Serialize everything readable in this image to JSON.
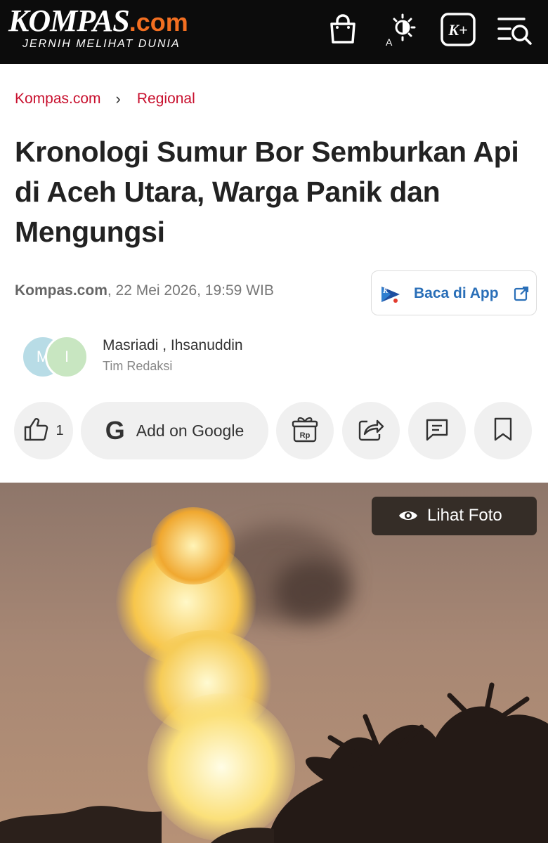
{
  "header": {
    "logo_main": "KOMPAS",
    "logo_suffix": ".com",
    "tagline": "JERNIH MELIHAT DUNIA",
    "icons": [
      "shopping-bag-icon",
      "theme-toggle-icon",
      "kompas-plus-icon",
      "search-menu-icon"
    ],
    "kplus_label": "K+"
  },
  "breadcrumb": {
    "items": [
      "Kompas.com",
      "Regional"
    ],
    "separator": "›"
  },
  "article": {
    "title": "Kronologi Sumur Bor Semburkan Api di Aceh Utara, Warga Panik dan Mengungsi",
    "source": "Kompas.com",
    "datetime": ", 22 Mei 2026, 19:59 WIB"
  },
  "app_button": {
    "label": "Baca di App",
    "logo_letter": "K"
  },
  "authors": {
    "avatar_initials": [
      "M",
      "I"
    ],
    "names": "Masriadi ,  Ihsanuddin",
    "team": "Tim Redaksi"
  },
  "actions": {
    "like_count": "1",
    "google_letter": "G",
    "google_label": "Add on Google",
    "gift_label": "Rp"
  },
  "photo": {
    "view_label": "Lihat Foto"
  },
  "colors": {
    "brand_red": "#c8102e",
    "logo_orange": "#f36f21",
    "header_bg": "#0c0c0c",
    "link_blue": "#2a6fb8"
  }
}
